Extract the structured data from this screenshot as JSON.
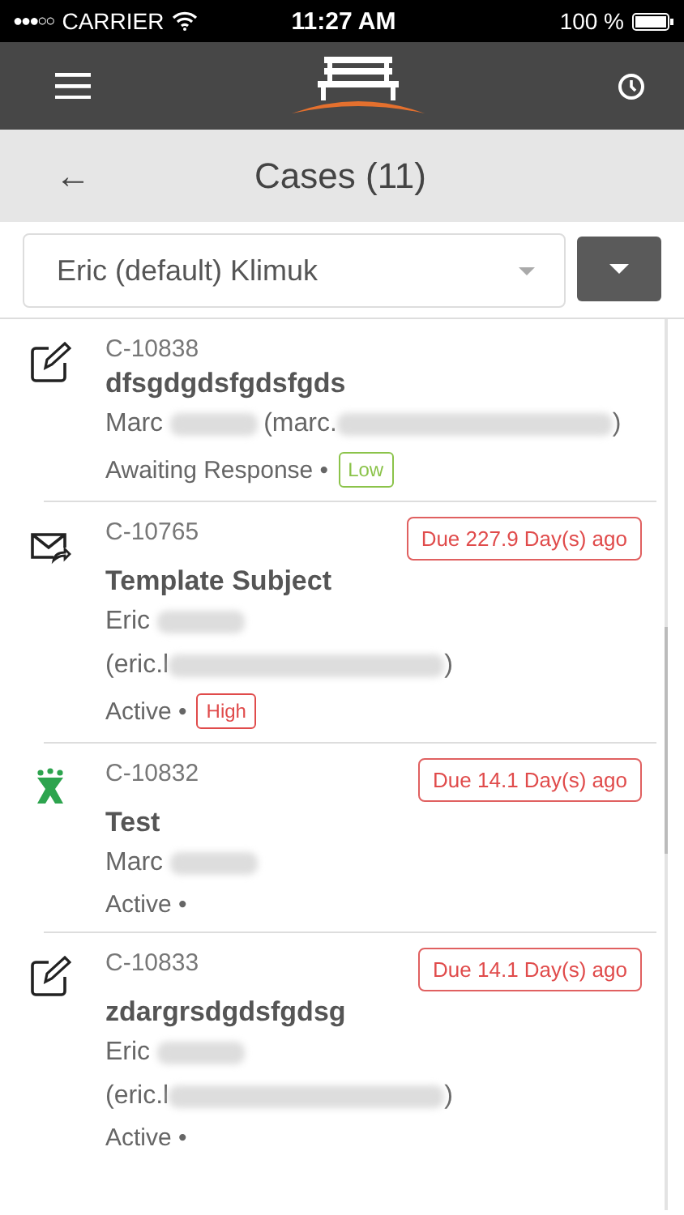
{
  "status_bar": {
    "signal": "●●●○○",
    "carrier": "CARRIER",
    "time": "11:27 AM",
    "battery": "100 %"
  },
  "title_bar": {
    "back": "←",
    "title": "Cases (11)"
  },
  "filter": {
    "value": "Eric (default) Klimuk"
  },
  "cases": [
    {
      "kind": "note",
      "id": "C-10838",
      "subject": "dfsgdgdsfgdsfgds",
      "contact": [
        [
          {
            "kind": "text",
            "text": "Marc"
          },
          {
            "kind": "redacted_name"
          },
          {
            "kind": "text",
            "text": "(marc."
          },
          {
            "kind": "redacted_email"
          },
          {
            "kind": "text",
            "text": ")"
          }
        ]
      ],
      "status": "Awaiting Response •",
      "priority": {
        "label": "Low",
        "color": "#8bc34a"
      }
    },
    {
      "kind": "mail",
      "id": "C-10765",
      "due": "Due 227.9 Day(s) ago",
      "subject": "Template Subject",
      "contact": [
        [
          {
            "kind": "text",
            "text": "Eric"
          },
          {
            "kind": "redacted_name"
          }
        ],
        [
          {
            "kind": "text",
            "text": "(eric.l"
          },
          {
            "kind": "redacted_email"
          },
          {
            "kind": "text",
            "text": ")"
          }
        ]
      ],
      "status": "Active •",
      "priority": {
        "label": "High",
        "color": "#e04b4b"
      }
    },
    {
      "kind": "person",
      "id": "C-10832",
      "due": "Due 14.1 Day(s) ago",
      "subject": "Test",
      "contact": [
        [
          {
            "kind": "text",
            "text": "Marc"
          },
          {
            "kind": "redacted_name"
          }
        ]
      ],
      "status": "Active •"
    },
    {
      "kind": "note",
      "id": "C-10833",
      "due": "Due 14.1 Day(s) ago",
      "subject": "zdargrsdgdsfgdsg",
      "contact": [
        [
          {
            "kind": "text",
            "text": "Eric"
          },
          {
            "kind": "redacted_name"
          }
        ],
        [
          {
            "kind": "text",
            "text": "(eric.l"
          },
          {
            "kind": "redacted_email"
          },
          {
            "kind": "text",
            "text": ")"
          }
        ]
      ],
      "status": "Active •"
    }
  ]
}
